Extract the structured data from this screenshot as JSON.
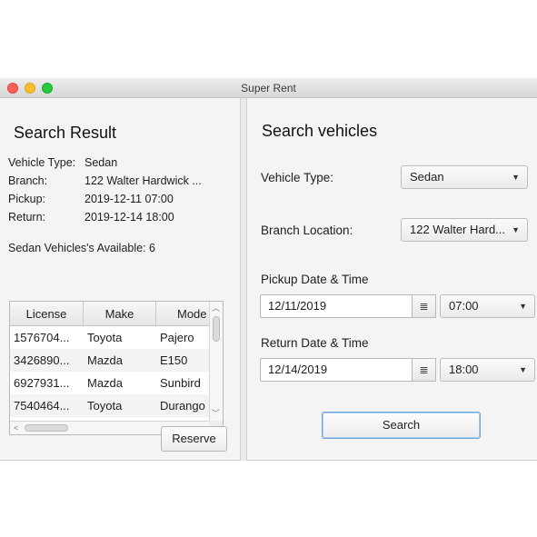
{
  "window": {
    "title": "Super Rent"
  },
  "left": {
    "heading": "Search Result",
    "info": [
      {
        "key": "Vehicle Type:",
        "value": "Sedan"
      },
      {
        "key": "Branch:",
        "value": "122 Walter Hardwick ..."
      },
      {
        "key": "Pickup:",
        "value": "2019-12-11 07:00"
      },
      {
        "key": "Return:",
        "value": "2019-12-14 18:00"
      }
    ],
    "available_text": "Sedan Vehicles's Available: 6",
    "table": {
      "columns": [
        "License",
        "Make",
        "Mode"
      ],
      "rows": [
        [
          "1576704...",
          "Toyota",
          "Pajero"
        ],
        [
          "3426890...",
          "Mazda",
          "E150"
        ],
        [
          "6927931...",
          "Mazda",
          "Sunbird"
        ],
        [
          "7540464...",
          "Toyota",
          "Durango"
        ]
      ]
    },
    "reserve_label": "Reserve"
  },
  "right": {
    "heading": "Search vehicles",
    "vehicle_type_label": "Vehicle Type:",
    "vehicle_type_value": "Sedan",
    "branch_label": "Branch Location:",
    "branch_value": "122 Walter Hard...",
    "pickup_label": "Pickup Date & Time",
    "pickup_date": "12/11/2019",
    "pickup_time": "07:00",
    "return_label": "Return Date & Time",
    "return_date": "12/14/2019",
    "return_time": "18:00",
    "search_label": "Search"
  },
  "icons": {
    "calendar": "≣",
    "dropdown": "▼",
    "arrow_up": "︿",
    "arrow_down": "﹀",
    "arrow_left": "<",
    "arrow_right": ">"
  }
}
